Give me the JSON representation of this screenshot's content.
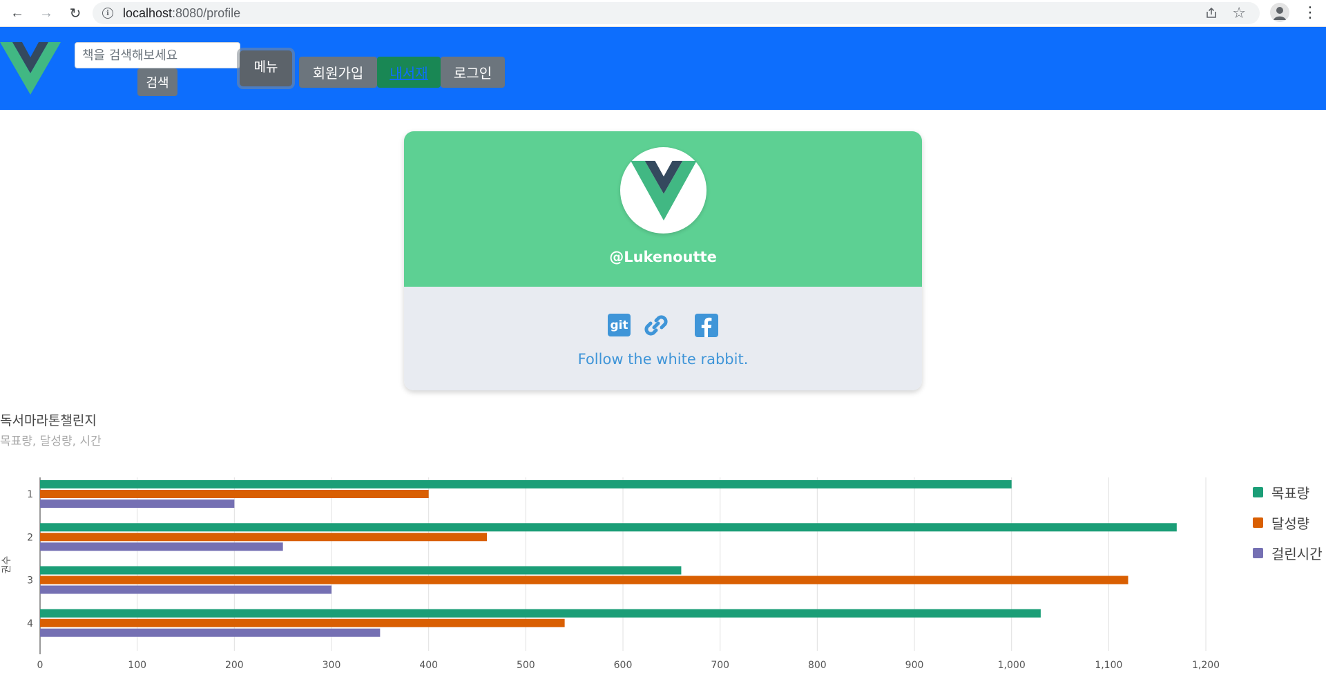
{
  "browser": {
    "url_host": "localhost",
    "url_path": ":8080/profile"
  },
  "header": {
    "search_placeholder": "책을 검색해보세요",
    "search_button": "검색",
    "menu_button": "메뉴",
    "signup_button": "회원가입",
    "mypage_button": "내서재",
    "login_button": "로그인"
  },
  "profile": {
    "username": "@Lukenoutte",
    "git_label": "git",
    "tagline": "Follow the white rabbit."
  },
  "chart_data": {
    "type": "bar",
    "orientation": "horizontal",
    "title": "독서마라톤챌린지",
    "subtitle": "목표량, 달성량, 시간",
    "ylabel": "권수",
    "categories": [
      "1",
      "2",
      "3",
      "4"
    ],
    "series": [
      {
        "name": "목표량",
        "color": "#1b9e77",
        "values": [
          1000,
          1170,
          660,
          1030
        ]
      },
      {
        "name": "달성량",
        "color": "#d95f02",
        "values": [
          400,
          460,
          1120,
          540
        ]
      },
      {
        "name": "걸린시간",
        "color": "#7570b3",
        "values": [
          200,
          250,
          300,
          350
        ]
      }
    ],
    "xlim": [
      0,
      1200
    ],
    "xticks": [
      "0",
      "100",
      "200",
      "300",
      "400",
      "500",
      "600",
      "700",
      "800",
      "900",
      "1,000",
      "1,100",
      "1,200"
    ],
    "grid": true,
    "legend_position": "right"
  }
}
